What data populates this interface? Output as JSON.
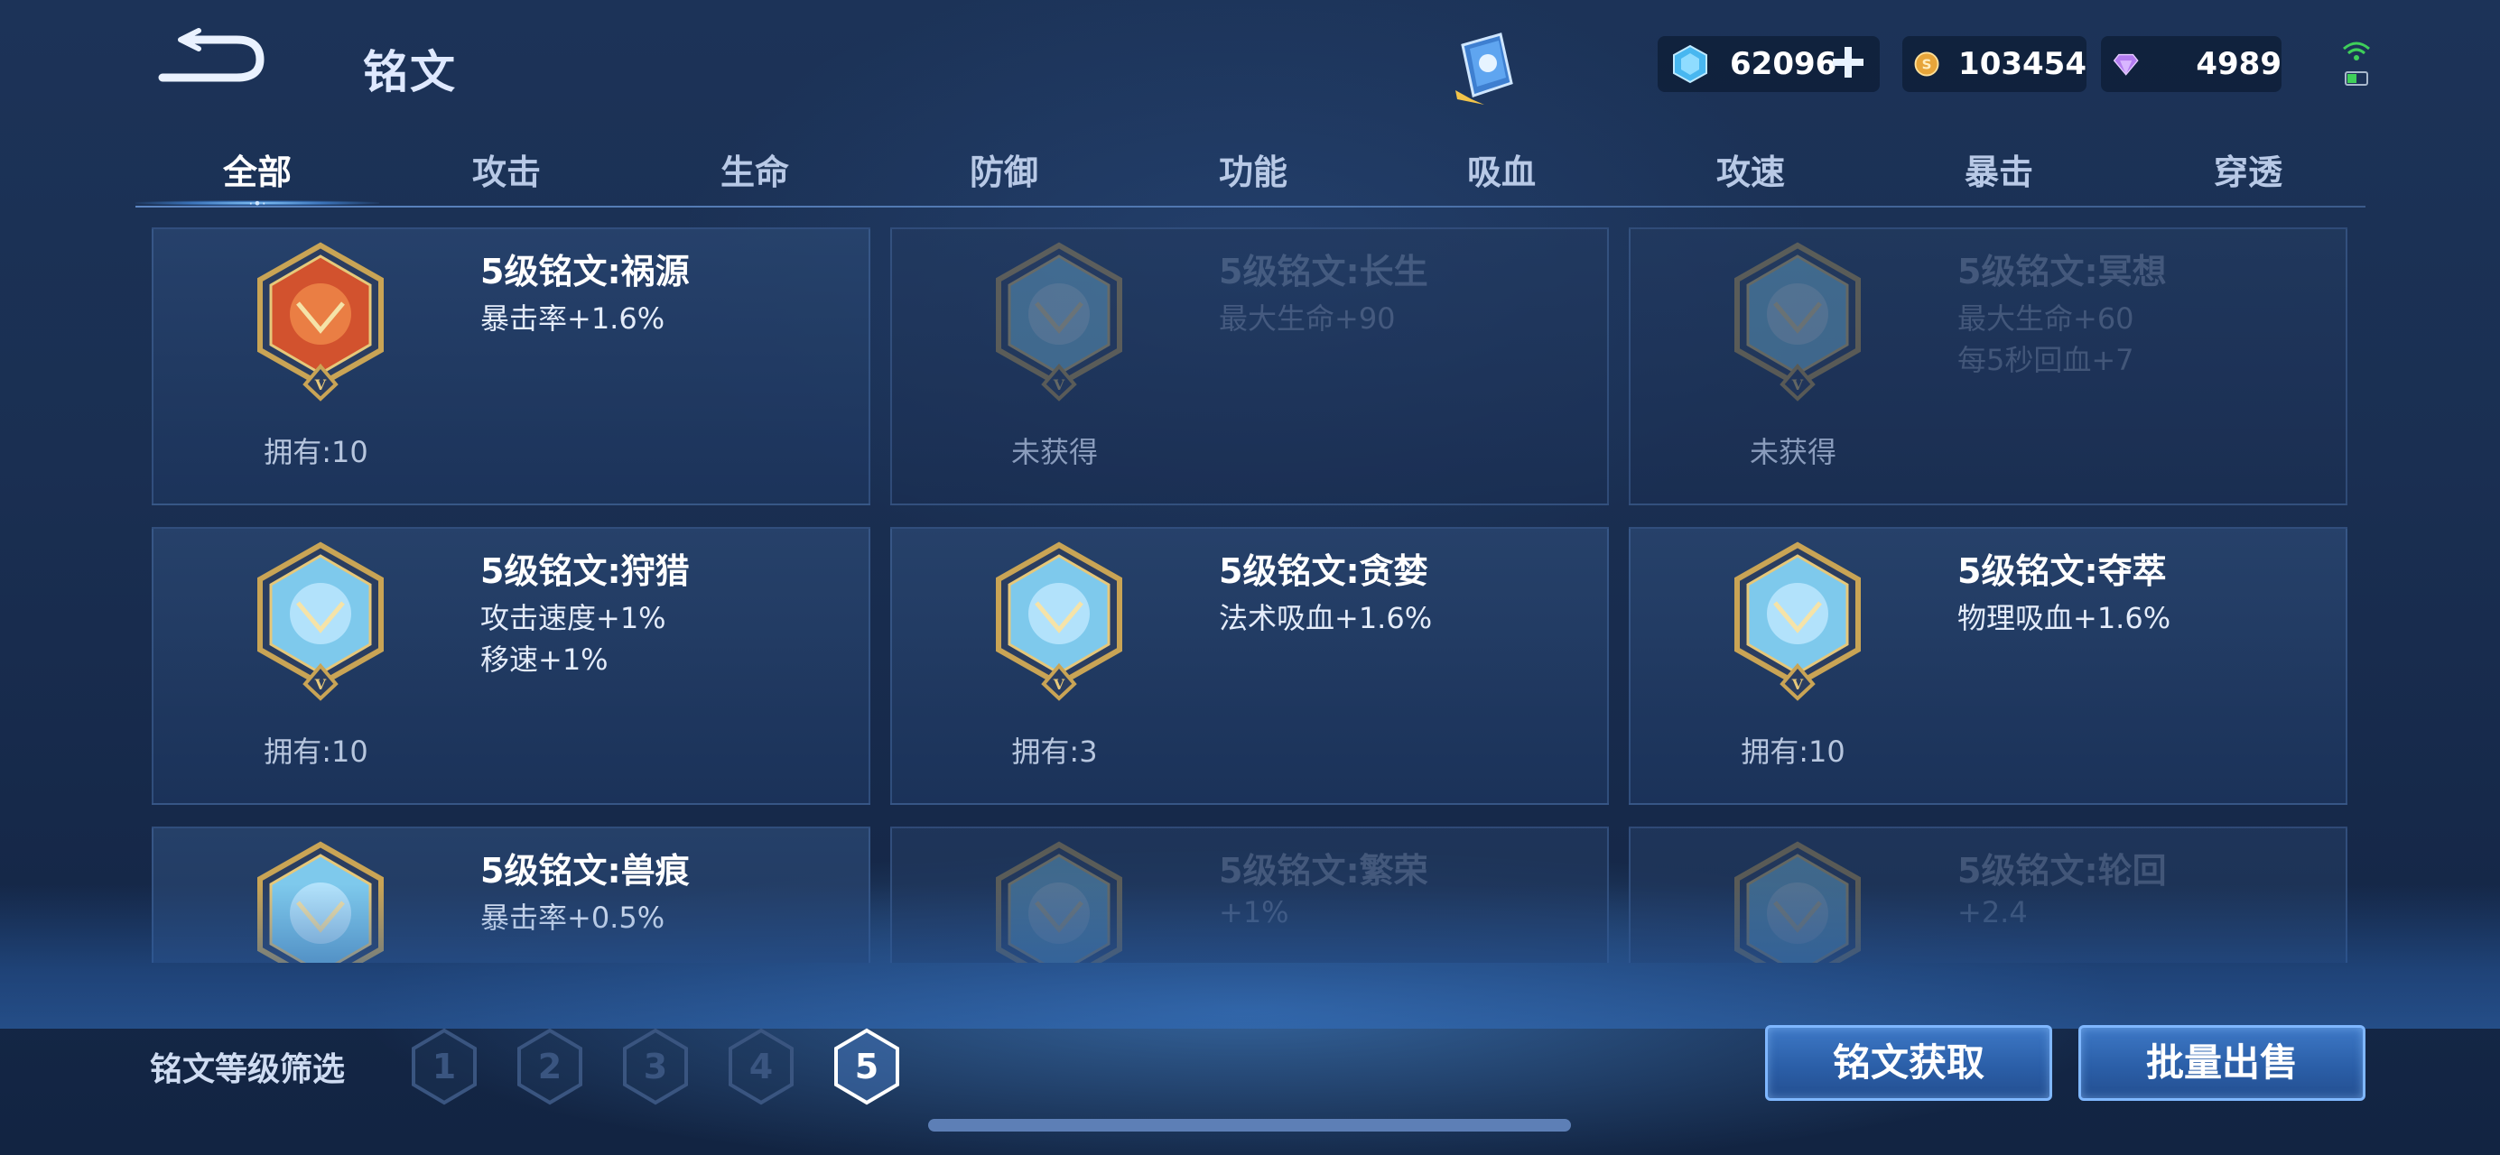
{
  "header": {
    "title": "铭文",
    "resources": {
      "gems": "62096",
      "coins": "103454",
      "diamonds": "4989"
    }
  },
  "tabs": [
    "全部",
    "攻击",
    "生命",
    "防御",
    "功能",
    "吸血",
    "攻速",
    "暴击",
    "穿透"
  ],
  "active_tab": "全部",
  "cards": [
    {
      "name": "5级铭文:祸源",
      "stats": [
        "暴击率+1.6%"
      ],
      "owned": "拥有:10",
      "obtained": true,
      "emblem": "red-emblem-icon"
    },
    {
      "name": "5级铭文:长生",
      "stats": [
        "最大生命+90"
      ],
      "owned": "未获得",
      "obtained": false,
      "emblem": "blue-emblem-icon"
    },
    {
      "name": "5级铭文:冥想",
      "stats": [
        "最大生命+60",
        "每5秒回血+7"
      ],
      "owned": "未获得",
      "obtained": false,
      "emblem": "blue-emblem-icon"
    },
    {
      "name": "5级铭文:狩猎",
      "stats": [
        "攻击速度+1%",
        "移速+1%"
      ],
      "owned": "拥有:10",
      "obtained": true,
      "emblem": "blue-emblem-icon"
    },
    {
      "name": "5级铭文:贪婪",
      "stats": [
        "法术吸血+1.6%"
      ],
      "owned": "拥有:3",
      "obtained": true,
      "emblem": "blue-emblem-icon"
    },
    {
      "name": "5级铭文:夺萃",
      "stats": [
        "物理吸血+1.6%"
      ],
      "owned": "拥有:10",
      "obtained": true,
      "emblem": "blue-emblem-icon"
    },
    {
      "name": "5级铭文:兽痕",
      "stats": [
        "暴击率+0.5%"
      ],
      "owned": "",
      "obtained": true,
      "emblem": "blue-emblem-icon"
    },
    {
      "name": "5级铭文:繁荣",
      "stats": [
        "+1%"
      ],
      "owned": "",
      "obtained": false,
      "emblem": "blue-emblem-icon"
    },
    {
      "name": "5级铭文:轮回",
      "stats": [
        "+2.4"
      ],
      "owned": "",
      "obtained": false,
      "emblem": "blue-emblem-icon"
    }
  ],
  "filter": {
    "label": "铭文等级筛选",
    "levels": [
      "1",
      "2",
      "3",
      "4",
      "5"
    ],
    "selected": "5"
  },
  "buttons": {
    "get": "铭文获取",
    "sell": "批量出售"
  },
  "colors": {
    "accent": "#7fb7ff",
    "background": "#1a2f52",
    "button": "#2b5fa8"
  }
}
